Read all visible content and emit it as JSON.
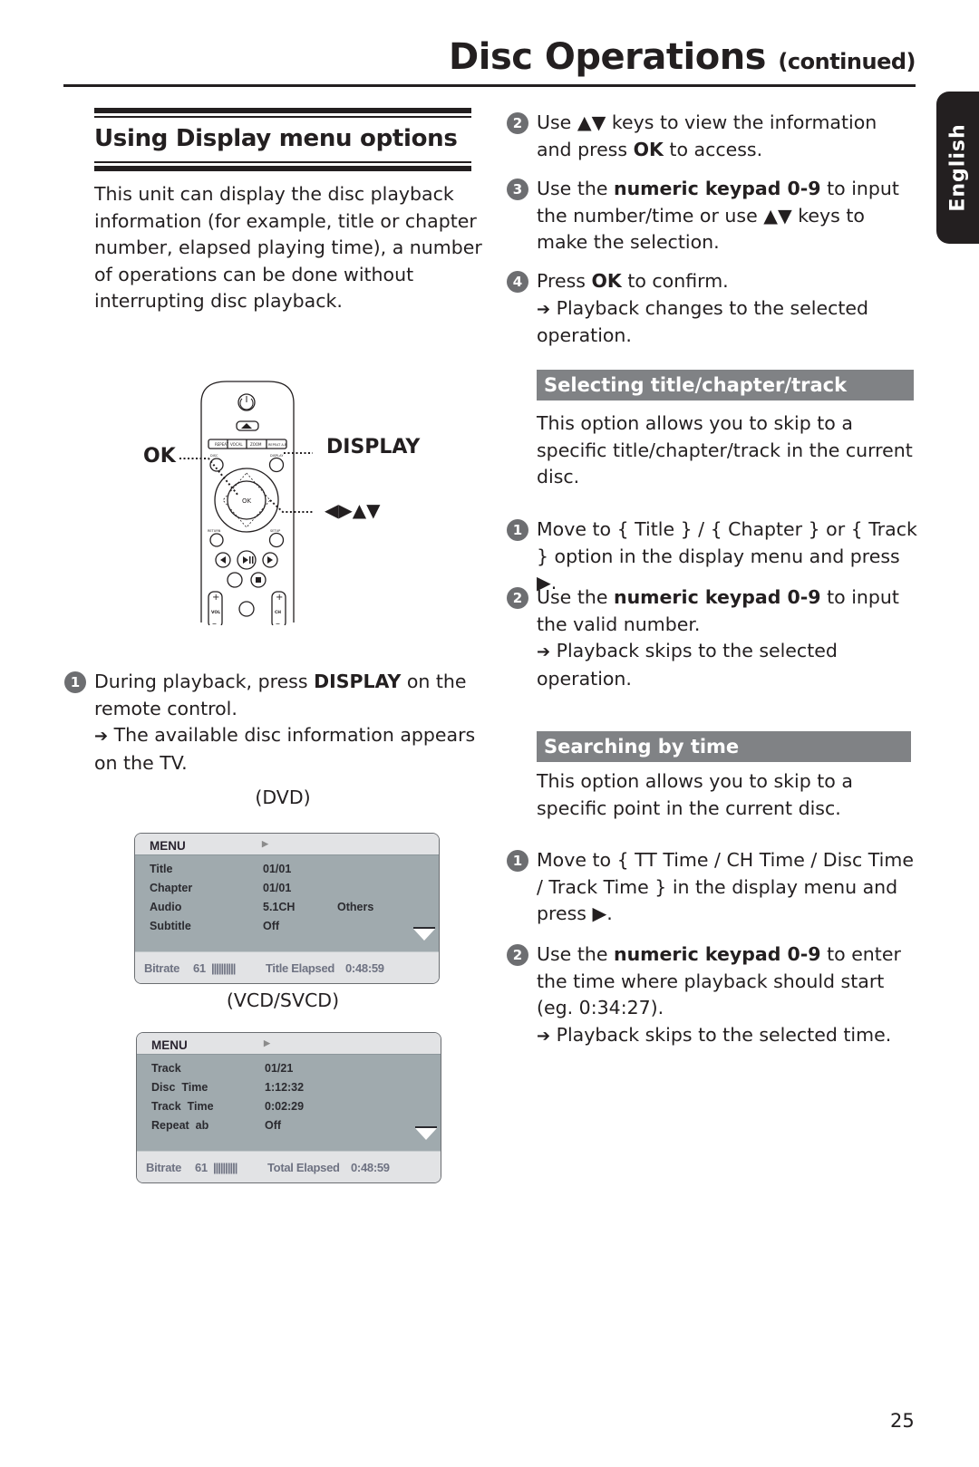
{
  "header": {
    "title": "Disc Operations",
    "title_suffix": "(continued)",
    "language_tab": "English"
  },
  "left": {
    "section_title": "Using Display menu options",
    "intro": "This unit can display the disc playback information (for example, title or chapter number, elapsed playing time), a number of operations can be done without interrupting disc playback.",
    "remote": {
      "ok_label": "OK",
      "display_label": "DISPLAY",
      "nav_label": "◀▶▲▼",
      "buttons": [
        "REPEAT",
        "VOCAL",
        "ZOOM",
        "REPEAT A-B",
        "DISC MENU",
        "DISPLAY",
        "OK",
        "RETURN TITLE",
        "SETUP",
        "VOL",
        "CH"
      ]
    },
    "step1": {
      "num": "1",
      "pre": "During playback, press ",
      "bold": "DISPLAY",
      "post": " on the remote control.",
      "result": "The available disc information appears on the TV."
    },
    "dvd_label": "(DVD)",
    "dvd_menu": {
      "header": "MENU",
      "rows": [
        {
          "label": "Title",
          "value": "01/01",
          "extra": ""
        },
        {
          "label": "Chapter",
          "value": "01/01",
          "extra": ""
        },
        {
          "label": "Audio",
          "value": "5.1CH",
          "extra": "Others"
        },
        {
          "label": "Subtitle",
          "value": "Off",
          "extra": ""
        }
      ],
      "footer": {
        "bitrate_label": "Bitrate",
        "bitrate_value": "61",
        "bars": "||||||||||",
        "elapsed_label": "Title Elapsed",
        "elapsed_value": "0:48:59"
      }
    },
    "vcd_label": "(VCD/SVCD)",
    "vcd_menu": {
      "header": "MENU",
      "rows": [
        {
          "label": "Track",
          "value": "01/21"
        },
        {
          "label": "Disc  Time",
          "value": "1:12:32"
        },
        {
          "label": "Track  Time",
          "value": "0:02:29"
        },
        {
          "label": "Repeat  ab",
          "value": "Off"
        }
      ],
      "footer": {
        "bitrate_label": "Bitrate",
        "bitrate_value": "61",
        "bars": "||||||||||",
        "elapsed_label": "Total Elapsed",
        "elapsed_value": "0:48:59"
      }
    }
  },
  "right": {
    "step2": {
      "num": "2",
      "pre": "Use ",
      "keys": "▲▼",
      "mid": " keys to view the information and press ",
      "bold": "OK",
      "post": " to access."
    },
    "step3": {
      "num": "3",
      "pre": "Use the ",
      "bold": "numeric keypad 0-9",
      "mid": " to input the number/time or use ",
      "keys": "▲▼",
      "post": " keys to make the selection."
    },
    "step4": {
      "num": "4",
      "pre": "Press ",
      "bold": "OK",
      "post": " to confirm.",
      "result": "Playback changes to the selected operation."
    },
    "selecting": {
      "heading": "Selecting title/chapter/track",
      "intro": "This option allows you to skip to a specific title/chapter/track in the current disc.",
      "step1": {
        "num": "1",
        "text": "Move to { Title } / { Chapter } or { Track } option in the display menu and press ",
        "key": "▶",
        "post": "."
      },
      "step2": {
        "num": "2",
        "pre": "Use the ",
        "bold": "numeric keypad 0-9",
        "post": " to input the valid number.",
        "result": "Playback skips to the selected operation."
      }
    },
    "searching": {
      "heading": "Searching by time",
      "intro": "This option allows you to skip to a specific point in the current disc.",
      "step1": {
        "num": "1",
        "text": "Move to { TT Time / CH Time / Disc Time / Track Time } in the display menu and press ",
        "key": "▶",
        "post": "."
      },
      "step2": {
        "num": "2",
        "pre": "Use the ",
        "bold": "numeric keypad 0-9",
        "post": " to enter the time where playback should start (eg. 0:34:27).",
        "result": "Playback skips to the selected time."
      }
    }
  },
  "footer": {
    "page_number": "25"
  },
  "arrow_glyph": "➔"
}
